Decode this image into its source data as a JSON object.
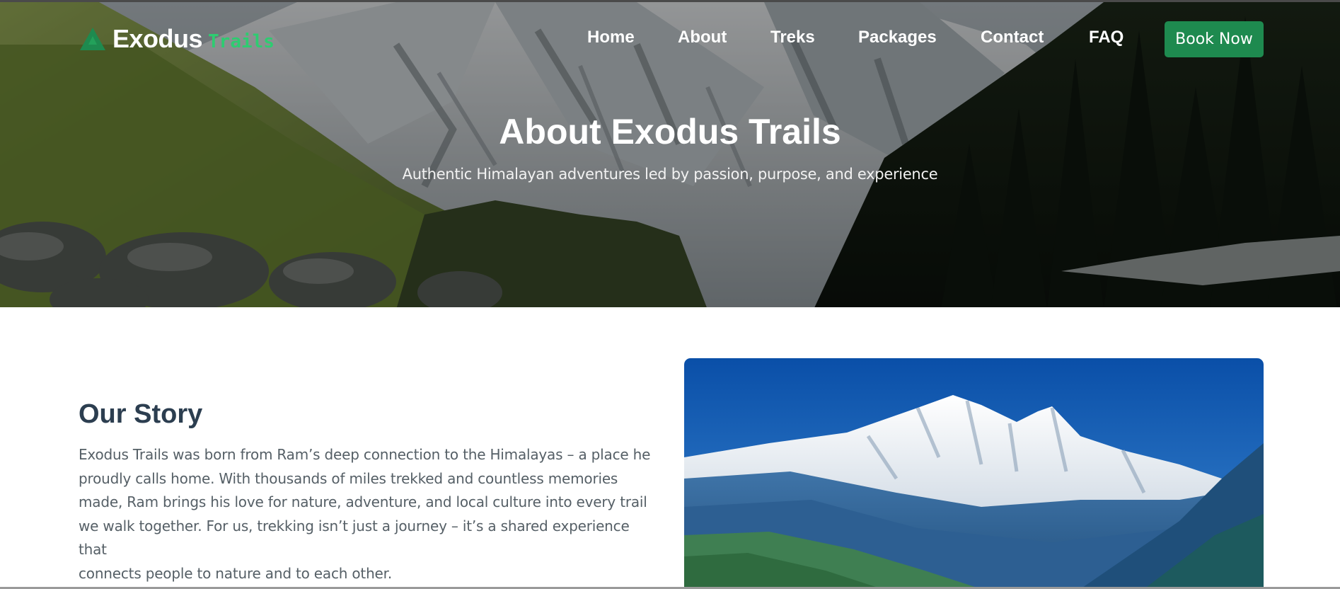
{
  "brand": {
    "name": "Exodus",
    "sub": "Trails",
    "accent_color": "#2ecc71",
    "icon": "mountain-icon"
  },
  "nav": {
    "items": [
      {
        "label": "Home"
      },
      {
        "label": "About"
      },
      {
        "label": "Treks"
      },
      {
        "label": "Packages"
      },
      {
        "label": "Contact"
      },
      {
        "label": "FAQ"
      }
    ],
    "cta_label": "Book Now",
    "cta_color": "#1e8a4f"
  },
  "hero": {
    "title": "About Exodus Trails",
    "subtitle": "Authentic Himalayan adventures led by passion, purpose, and experience"
  },
  "story": {
    "title": "Our Story",
    "lines": [
      "Exodus Trails was born from Ram’s deep connection to the Himalayas – a place he",
      "proudly calls home. With thousands of miles trekked and countless memories",
      "made, Ram brings his love for nature, adventure, and local culture into every trail",
      "we walk together. For us, trekking isn’t just a journey – it’s a shared experience that",
      "connects people to nature and to each other."
    ],
    "title_color": "#2c3e50"
  }
}
